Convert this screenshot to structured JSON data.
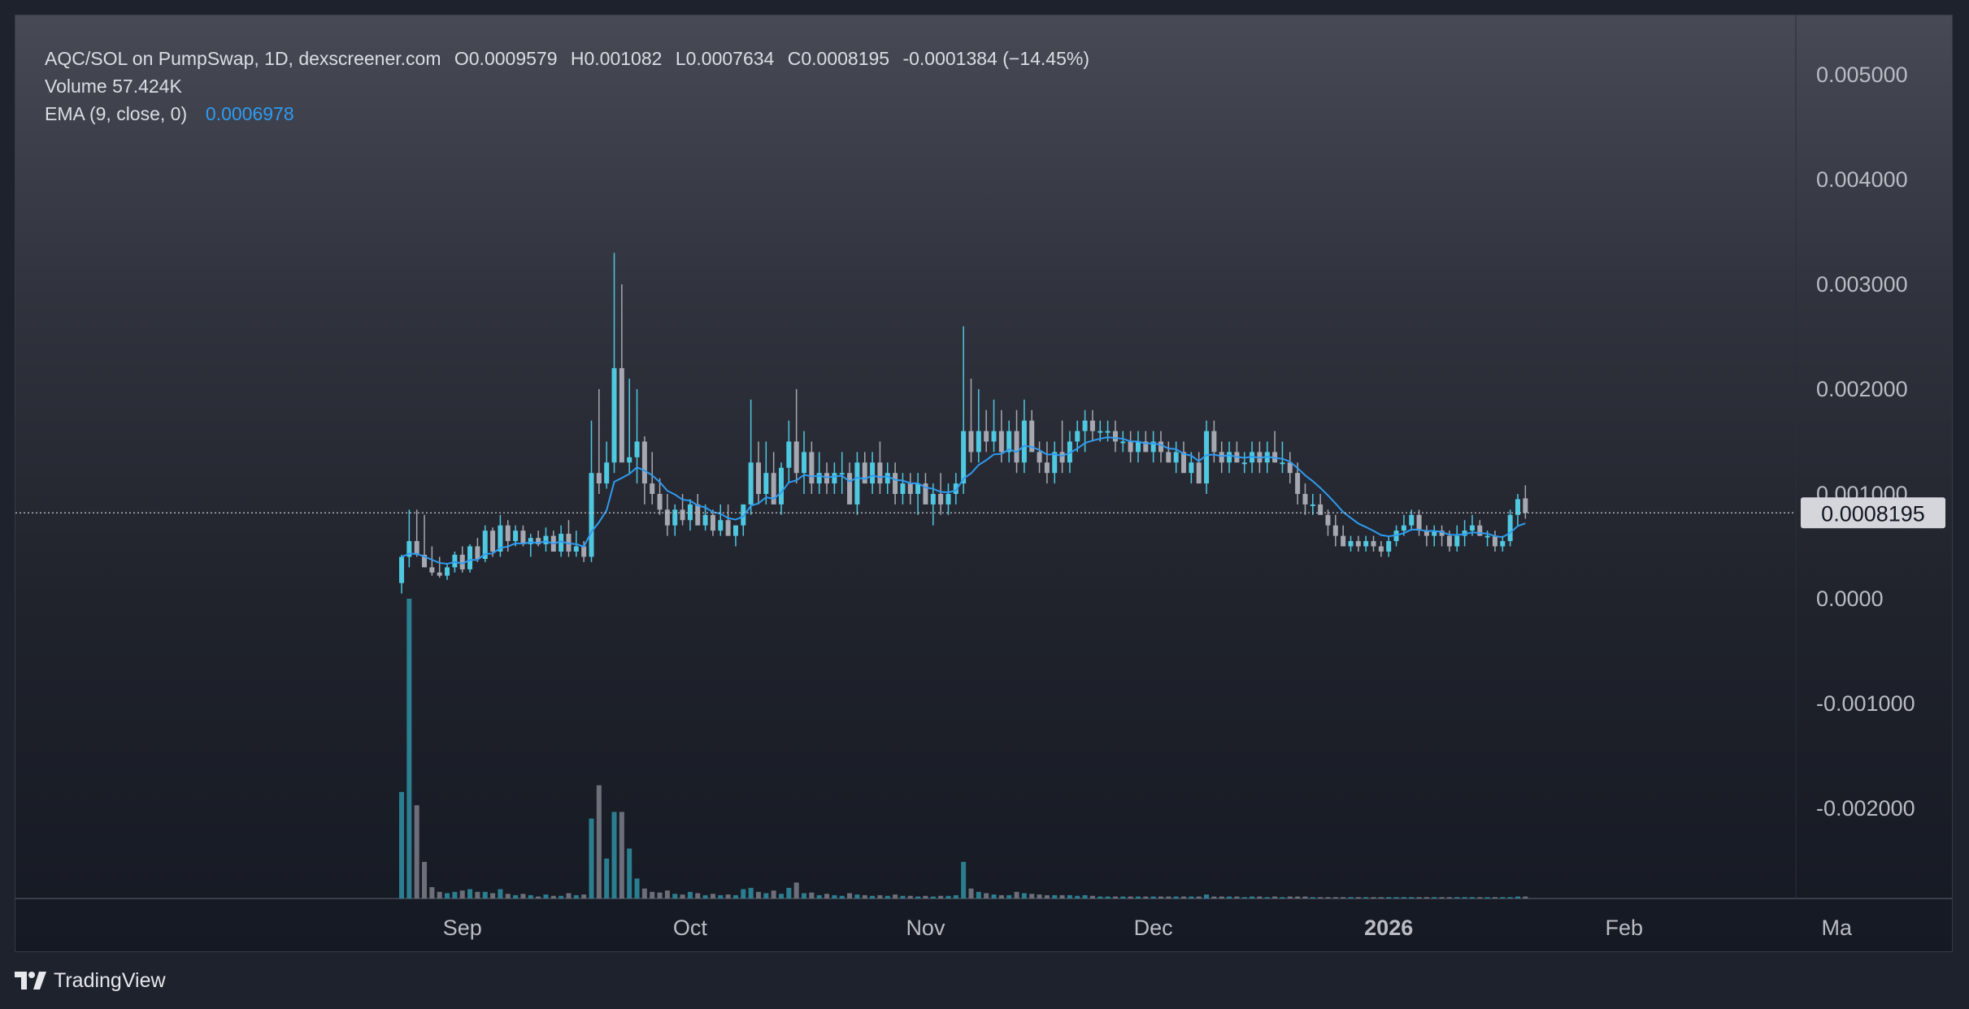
{
  "legend": {
    "symbol_line": "AQC/SOL on PumpSwap, 1D, dexscreener.com",
    "open": "O0.0009579",
    "high": "H0.001082",
    "low": "L0.0007634",
    "close": "C0.0008195",
    "change": "-0.0001384 (−14.45%)",
    "volume_label": "Volume",
    "volume_value": "57.424K",
    "ema_label": "EMA (9, close, 0)",
    "ema_value": "0.0006978"
  },
  "brand": {
    "name": "TradingView"
  },
  "colors": {
    "up": "#4fc8e0",
    "down": "#a5a8b1",
    "ema": "#2f9bf0",
    "price_label_bg": "#d4d6db",
    "axis_text": "#b9bcc4"
  },
  "chart_data": {
    "type": "candlestick",
    "interval": "1D",
    "price_axis": {
      "ticks": [
        {
          "value": 0.005,
          "label": "0.005000"
        },
        {
          "value": 0.004,
          "label": "0.004000"
        },
        {
          "value": 0.003,
          "label": "0.003000"
        },
        {
          "value": 0.002,
          "label": "0.002000"
        },
        {
          "value": 0.001,
          "label": "0.001000"
        },
        {
          "value": 0.0,
          "label": "0.0000"
        },
        {
          "value": -0.001,
          "label": "-0.001000"
        },
        {
          "value": -0.002,
          "label": "-0.002000"
        }
      ],
      "last_price": 0.0008195,
      "last_price_label": "0.0008195"
    },
    "time_axis": {
      "ticks": [
        {
          "day": 8,
          "label": "Sep",
          "bold": false
        },
        {
          "day": 38,
          "label": "Oct",
          "bold": false
        },
        {
          "day": 69,
          "label": "Nov",
          "bold": false
        },
        {
          "day": 99,
          "label": "Dec",
          "bold": false
        },
        {
          "day": 130,
          "label": "2026",
          "bold": true
        },
        {
          "day": 161,
          "label": "Feb",
          "bold": false
        },
        {
          "day": 189,
          "label": "Ma",
          "bold": false
        }
      ]
    },
    "first_bar_day": 0,
    "candles": [
      [
        0.00015,
        0.00042,
        5e-05,
        0.0004,
        1.6
      ],
      [
        0.0004,
        0.00085,
        0.0003,
        0.00055,
        4.5
      ],
      [
        0.00055,
        0.00085,
        0.0004,
        0.00042,
        1.4
      ],
      [
        0.00042,
        0.0008,
        0.0003,
        0.0003,
        0.55
      ],
      [
        0.0003,
        0.0005,
        0.00022,
        0.00025,
        0.17
      ],
      [
        0.00025,
        0.0004,
        0.0002,
        0.00022,
        0.1
      ],
      [
        0.00022,
        0.00033,
        0.00018,
        0.0003,
        0.08
      ],
      [
        0.0003,
        0.00045,
        0.00025,
        0.00042,
        0.1
      ],
      [
        0.00042,
        0.0005,
        0.00025,
        0.00028,
        0.12
      ],
      [
        0.00028,
        0.00052,
        0.00025,
        0.0005,
        0.14
      ],
      [
        0.0005,
        0.00058,
        0.00035,
        0.00038,
        0.1
      ],
      [
        0.00038,
        0.0007,
        0.00035,
        0.00065,
        0.1
      ],
      [
        0.00065,
        0.00068,
        0.0004,
        0.00045,
        0.08
      ],
      [
        0.00045,
        0.0008,
        0.0004,
        0.0007,
        0.14
      ],
      [
        0.0007,
        0.00075,
        0.00045,
        0.00055,
        0.07
      ],
      [
        0.00055,
        0.0007,
        0.0005,
        0.00065,
        0.05
      ],
      [
        0.00065,
        0.0007,
        0.0005,
        0.00052,
        0.07
      ],
      [
        0.00052,
        0.00062,
        0.0004,
        0.00058,
        0.05
      ],
      [
        0.00058,
        0.00065,
        0.0005,
        0.00052,
        0.03
      ],
      [
        0.00052,
        0.00068,
        0.00045,
        0.0006,
        0.06
      ],
      [
        0.0006,
        0.00065,
        0.00045,
        0.00045,
        0.04
      ],
      [
        0.00045,
        0.0007,
        0.0004,
        0.00062,
        0.04
      ],
      [
        0.00062,
        0.00075,
        0.0004,
        0.00045,
        0.08
      ],
      [
        0.00045,
        0.00065,
        0.0004,
        0.0005,
        0.05
      ],
      [
        0.0005,
        0.00055,
        0.00035,
        0.0004,
        0.06
      ],
      [
        0.0004,
        0.0017,
        0.00035,
        0.0012,
        1.2
      ],
      [
        0.0012,
        0.002,
        0.001,
        0.0011,
        1.7
      ],
      [
        0.0011,
        0.0015,
        0.00105,
        0.0013,
        0.6
      ],
      [
        0.0013,
        0.0033,
        0.0012,
        0.0022,
        1.3
      ],
      [
        0.0022,
        0.003,
        0.0017,
        0.0013,
        1.3
      ],
      [
        0.0013,
        0.0021,
        0.0012,
        0.00135,
        0.75
      ],
      [
        0.00135,
        0.002,
        0.0011,
        0.0015,
        0.3
      ],
      [
        0.0015,
        0.00155,
        0.0009,
        0.0011,
        0.15
      ],
      [
        0.0011,
        0.0014,
        0.0009,
        0.001,
        0.1
      ],
      [
        0.001,
        0.00115,
        0.0008,
        0.00085,
        0.09
      ],
      [
        0.00085,
        0.001,
        0.0006,
        0.0007,
        0.12
      ],
      [
        0.0007,
        0.0009,
        0.0006,
        0.00085,
        0.07
      ],
      [
        0.00085,
        0.001,
        0.0007,
        0.00075,
        0.06
      ],
      [
        0.00075,
        0.00095,
        0.00065,
        0.0009,
        0.1
      ],
      [
        0.0009,
        0.001,
        0.0007,
        0.0007,
        0.08
      ],
      [
        0.0007,
        0.0009,
        0.00065,
        0.0008,
        0.05
      ],
      [
        0.0008,
        0.00085,
        0.0006,
        0.00065,
        0.07
      ],
      [
        0.00065,
        0.0009,
        0.0006,
        0.00075,
        0.05
      ],
      [
        0.00075,
        0.0009,
        0.0006,
        0.0006,
        0.06
      ],
      [
        0.0006,
        0.0007,
        0.0005,
        0.0007,
        0.05
      ],
      [
        0.0007,
        0.0009,
        0.0006,
        0.0009,
        0.14
      ],
      [
        0.0009,
        0.0019,
        0.0008,
        0.0013,
        0.16
      ],
      [
        0.0013,
        0.0015,
        0.0009,
        0.001,
        0.1
      ],
      [
        0.001,
        0.0015,
        0.0009,
        0.0012,
        0.08
      ],
      [
        0.0012,
        0.0014,
        0.0009,
        0.0009,
        0.12
      ],
      [
        0.0009,
        0.0013,
        0.0008,
        0.00125,
        0.07
      ],
      [
        0.00125,
        0.0017,
        0.0011,
        0.0015,
        0.16
      ],
      [
        0.0015,
        0.002,
        0.0011,
        0.0012,
        0.24
      ],
      [
        0.0012,
        0.0016,
        0.001,
        0.0014,
        0.08
      ],
      [
        0.0014,
        0.0015,
        0.001,
        0.0011,
        0.09
      ],
      [
        0.0011,
        0.0014,
        0.001,
        0.0012,
        0.05
      ],
      [
        0.0012,
        0.0013,
        0.001,
        0.0011,
        0.07
      ],
      [
        0.0011,
        0.0013,
        0.001,
        0.0012,
        0.05
      ],
      [
        0.0012,
        0.0014,
        0.001,
        0.0012,
        0.04
      ],
      [
        0.0012,
        0.0013,
        0.0009,
        0.0009,
        0.08
      ],
      [
        0.0009,
        0.0014,
        0.0008,
        0.0013,
        0.06
      ],
      [
        0.0013,
        0.0014,
        0.0011,
        0.0011,
        0.05
      ],
      [
        0.0011,
        0.0014,
        0.001,
        0.0013,
        0.04
      ],
      [
        0.0013,
        0.0015,
        0.001,
        0.0011,
        0.05
      ],
      [
        0.0011,
        0.0013,
        0.001,
        0.0012,
        0.04
      ],
      [
        0.0012,
        0.0013,
        0.0009,
        0.001,
        0.06
      ],
      [
        0.001,
        0.0012,
        0.0009,
        0.0011,
        0.04
      ],
      [
        0.0011,
        0.0012,
        0.0009,
        0.001,
        0.04
      ],
      [
        0.001,
        0.0012,
        0.0008,
        0.0011,
        0.03
      ],
      [
        0.0011,
        0.0012,
        0.0009,
        0.0009,
        0.04
      ],
      [
        0.0009,
        0.0011,
        0.0007,
        0.001,
        0.03
      ],
      [
        0.001,
        0.0012,
        0.0008,
        0.0009,
        0.04
      ],
      [
        0.0009,
        0.0011,
        0.0008,
        0.001,
        0.04
      ],
      [
        0.001,
        0.0012,
        0.0009,
        0.0011,
        0.05
      ],
      [
        0.0011,
        0.0026,
        0.001,
        0.0016,
        0.55
      ],
      [
        0.0016,
        0.0021,
        0.0013,
        0.0014,
        0.15
      ],
      [
        0.0014,
        0.002,
        0.0013,
        0.0016,
        0.1
      ],
      [
        0.0016,
        0.0018,
        0.0014,
        0.0015,
        0.08
      ],
      [
        0.0015,
        0.0019,
        0.0014,
        0.0016,
        0.06
      ],
      [
        0.0016,
        0.0018,
        0.0013,
        0.0014,
        0.05
      ],
      [
        0.0014,
        0.0017,
        0.0013,
        0.0016,
        0.05
      ],
      [
        0.0016,
        0.0018,
        0.0012,
        0.0013,
        0.1
      ],
      [
        0.0013,
        0.0019,
        0.0012,
        0.0017,
        0.08
      ],
      [
        0.0017,
        0.0018,
        0.0014,
        0.0014,
        0.07
      ],
      [
        0.0014,
        0.0015,
        0.0012,
        0.0013,
        0.06
      ],
      [
        0.0013,
        0.0015,
        0.0011,
        0.0012,
        0.05
      ],
      [
        0.0012,
        0.0015,
        0.0011,
        0.0014,
        0.05
      ],
      [
        0.0014,
        0.0017,
        0.0012,
        0.0013,
        0.05
      ],
      [
        0.0013,
        0.0016,
        0.0012,
        0.0015,
        0.05
      ],
      [
        0.0015,
        0.0017,
        0.0014,
        0.0016,
        0.04
      ],
      [
        0.0016,
        0.0018,
        0.0014,
        0.0017,
        0.05
      ],
      [
        0.0017,
        0.0018,
        0.0015,
        0.0016,
        0.04
      ],
      [
        0.0016,
        0.0017,
        0.0015,
        0.0016,
        0.03
      ],
      [
        0.0016,
        0.0017,
        0.0015,
        0.0016,
        0.03
      ],
      [
        0.0016,
        0.0017,
        0.0014,
        0.0015,
        0.03
      ],
      [
        0.0015,
        0.0016,
        0.0014,
        0.0015,
        0.03
      ],
      [
        0.0015,
        0.0016,
        0.0013,
        0.0014,
        0.03
      ],
      [
        0.0014,
        0.0016,
        0.0013,
        0.0015,
        0.03
      ],
      [
        0.0015,
        0.0016,
        0.0014,
        0.0014,
        0.03
      ],
      [
        0.0014,
        0.0016,
        0.0013,
        0.0015,
        0.03
      ],
      [
        0.0015,
        0.0016,
        0.0013,
        0.0014,
        0.03
      ],
      [
        0.0014,
        0.0015,
        0.0013,
        0.0013,
        0.03
      ],
      [
        0.0013,
        0.0015,
        0.0012,
        0.0014,
        0.03
      ],
      [
        0.0014,
        0.0015,
        0.0012,
        0.0012,
        0.03
      ],
      [
        0.0012,
        0.0014,
        0.0011,
        0.0013,
        0.03
      ],
      [
        0.0013,
        0.0014,
        0.0011,
        0.0011,
        0.03
      ],
      [
        0.0011,
        0.0017,
        0.001,
        0.0016,
        0.06
      ],
      [
        0.0016,
        0.0017,
        0.0013,
        0.0014,
        0.03
      ],
      [
        0.0014,
        0.0015,
        0.0012,
        0.0013,
        0.03
      ],
      [
        0.0013,
        0.0015,
        0.0012,
        0.0014,
        0.03
      ],
      [
        0.0014,
        0.0015,
        0.0013,
        0.0013,
        0.03
      ],
      [
        0.0013,
        0.0014,
        0.0012,
        0.0013,
        0.02
      ],
      [
        0.0013,
        0.0015,
        0.0012,
        0.0014,
        0.03
      ],
      [
        0.0014,
        0.0015,
        0.0012,
        0.0013,
        0.03
      ],
      [
        0.0013,
        0.0015,
        0.0012,
        0.0014,
        0.02
      ],
      [
        0.0014,
        0.0016,
        0.0013,
        0.0013,
        0.03
      ],
      [
        0.0013,
        0.0015,
        0.0012,
        0.0013,
        0.02
      ],
      [
        0.0013,
        0.0014,
        0.0011,
        0.0012,
        0.03
      ],
      [
        0.0012,
        0.0013,
        0.0009,
        0.001,
        0.03
      ],
      [
        0.001,
        0.0011,
        0.0008,
        0.0009,
        0.03
      ],
      [
        0.0009,
        0.001,
        0.0008,
        0.0009,
        0.02
      ],
      [
        0.0009,
        0.001,
        0.0008,
        0.0008,
        0.02
      ],
      [
        0.0008,
        0.00085,
        0.0006,
        0.0007,
        0.02
      ],
      [
        0.0007,
        0.0008,
        0.0005,
        0.0006,
        0.02
      ],
      [
        0.0006,
        0.0007,
        0.0005,
        0.0005,
        0.02
      ],
      [
        0.0005,
        0.0006,
        0.00045,
        0.00055,
        0.02
      ],
      [
        0.00055,
        0.0006,
        0.00045,
        0.0005,
        0.02
      ],
      [
        0.0005,
        0.0006,
        0.00045,
        0.00055,
        0.02
      ],
      [
        0.00055,
        0.0006,
        0.00045,
        0.0005,
        0.02
      ],
      [
        0.0005,
        0.00055,
        0.0004,
        0.00045,
        0.02
      ],
      [
        0.00045,
        0.0006,
        0.0004,
        0.00055,
        0.02
      ],
      [
        0.00055,
        0.0007,
        0.0005,
        0.00065,
        0.02
      ],
      [
        0.00065,
        0.0008,
        0.0006,
        0.0007,
        0.02
      ],
      [
        0.0007,
        0.00085,
        0.00065,
        0.0008,
        0.02
      ],
      [
        0.0008,
        0.00085,
        0.0006,
        0.00065,
        0.02
      ],
      [
        0.00065,
        0.0007,
        0.0005,
        0.0006,
        0.02
      ],
      [
        0.0006,
        0.0007,
        0.0005,
        0.00065,
        0.02
      ],
      [
        0.00065,
        0.0007,
        0.0005,
        0.0006,
        0.02
      ],
      [
        0.0006,
        0.00065,
        0.00045,
        0.0005,
        0.02
      ],
      [
        0.0005,
        0.0007,
        0.00045,
        0.0006,
        0.02
      ],
      [
        0.0006,
        0.00075,
        0.0005,
        0.00065,
        0.02
      ],
      [
        0.00065,
        0.0008,
        0.0006,
        0.0007,
        0.02
      ],
      [
        0.0007,
        0.00075,
        0.0006,
        0.0006,
        0.02
      ],
      [
        0.0006,
        0.00065,
        0.0005,
        0.0006,
        0.02
      ],
      [
        0.0006,
        0.00065,
        0.00045,
        0.0005,
        0.02
      ],
      [
        0.0005,
        0.0006,
        0.00045,
        0.00055,
        0.02
      ],
      [
        0.00055,
        0.00085,
        0.0005,
        0.0008,
        0.02
      ],
      [
        0.0008,
        0.001,
        0.0007,
        0.00095,
        0.03
      ],
      [
        0.0009579,
        0.001082,
        0.0007634,
        0.0008195,
        0.03
      ]
    ],
    "ema": {
      "period": 9,
      "last_value": 0.0006978
    }
  }
}
